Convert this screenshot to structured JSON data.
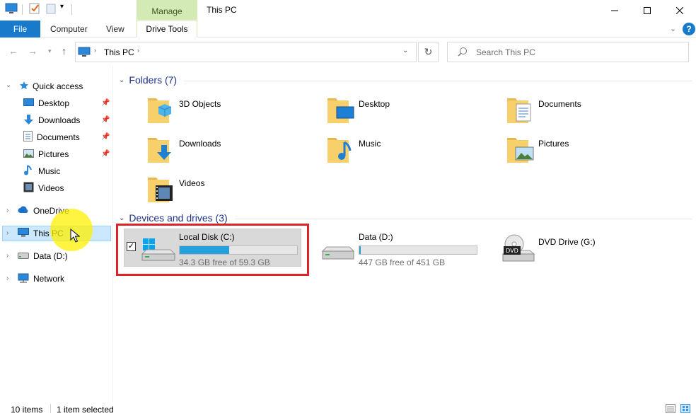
{
  "window": {
    "title": "This PC",
    "manage_tab": "Manage"
  },
  "ribbon": {
    "file": "File",
    "computer": "Computer",
    "view": "View",
    "drive_tools": "Drive Tools",
    "help": "?"
  },
  "address": {
    "location": "This PC",
    "search_placeholder": "Search This PC"
  },
  "nav": {
    "quick_access": "Quick access",
    "items": [
      {
        "label": "Desktop",
        "pinned": true
      },
      {
        "label": "Downloads",
        "pinned": true
      },
      {
        "label": "Documents",
        "pinned": true
      },
      {
        "label": "Pictures",
        "pinned": true
      },
      {
        "label": "Music",
        "pinned": false
      },
      {
        "label": "Videos",
        "pinned": false
      }
    ],
    "onedrive": "OneDrive",
    "this_pc": "This PC",
    "data_drive": "Data (D:)",
    "network": "Network"
  },
  "folders": {
    "header": "Folders (7)",
    "items": [
      "3D Objects",
      "Desktop",
      "Documents",
      "Downloads",
      "Music",
      "Pictures",
      "Videos"
    ]
  },
  "drives": {
    "header": "Devices and drives (3)",
    "items": [
      {
        "label": "Local Disk (C:)",
        "free": "34.3 GB free of 59.3 GB",
        "used_fraction": 0.42
      },
      {
        "label": "Data (D:)",
        "free": "447 GB free of 451 GB",
        "used_fraction": 0.01
      },
      {
        "label": "DVD Drive (G:)",
        "free": "",
        "used_fraction": null
      }
    ],
    "dvd_badge": "DVD"
  },
  "status": {
    "items": "10 items",
    "selected": "1 item selected"
  },
  "colors": {
    "accent": "#1979ca",
    "manage_green": "#d3eab4",
    "bar_fill": "#26a0da",
    "highlight_red": "#d8242a",
    "group_header": "#1e3287"
  }
}
